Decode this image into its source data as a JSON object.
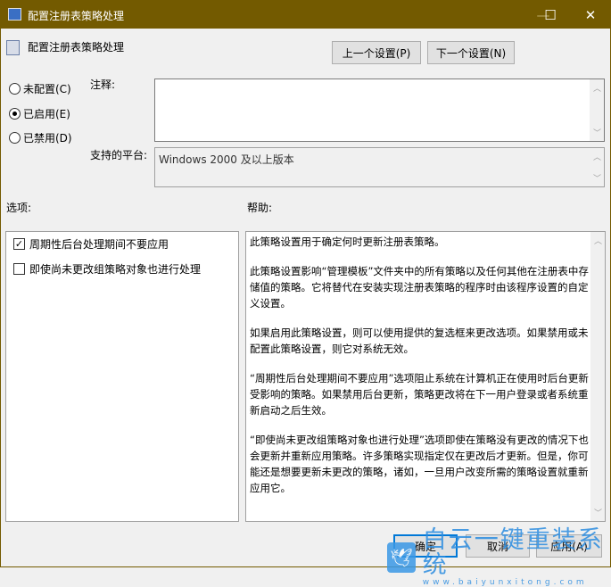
{
  "window": {
    "title": "配置注册表策略处理",
    "controls": {
      "minimize": "—",
      "maximize": "☐",
      "close": "✕"
    }
  },
  "header": {
    "policy_name": "配置注册表策略处理",
    "prev_button": "上一个设置(P)",
    "next_button": "下一个设置(N)"
  },
  "state": {
    "options": [
      {
        "label": "未配置(C)",
        "selected": false
      },
      {
        "label": "已启用(E)",
        "selected": true
      },
      {
        "label": "已禁用(D)",
        "selected": false
      }
    ]
  },
  "comment": {
    "label": "注释:",
    "value": ""
  },
  "platform": {
    "label": "支持的平台:",
    "value": "Windows 2000 及以上版本"
  },
  "options_panel": {
    "label": "选项:",
    "checkboxes": [
      {
        "label": "周期性后台处理期间不要应用",
        "checked": true
      },
      {
        "label": "即使尚未更改组策略对象也进行处理",
        "checked": false
      }
    ]
  },
  "help_panel": {
    "label": "帮助:",
    "paragraphs": [
      "此策略设置用于确定何时更新注册表策略。",
      "此策略设置影响“管理模板”文件夹中的所有策略以及任何其他在注册表中存储值的策略。它将替代在安装实现注册表策略的程序时由该程序设置的自定义设置。",
      "如果启用此策略设置，则可以使用提供的复选框来更改选项。如果禁用或未配置此策略设置，则它对系统无效。",
      "“周期性后台处理期间不要应用”选项阻止系统在计算机正在使用时后台更新受影响的策略。如果禁用后台更新，策略更改将在下一用户登录或者系统重新启动之后生效。",
      "“即使尚未更改组策略对象也进行处理”选项即使在策略没有更改的情况下也会更新并重新应用策略。许多策略实现指定仅在更改后才更新。但是，你可能还是想要更新未更改的策略，诸如，一旦用户改变所需的策略设置就重新应用它。"
    ]
  },
  "footer": {
    "ok": "确定",
    "cancel": "取消",
    "apply": "应用(A)"
  },
  "watermark": {
    "title": "白云一键重装系统",
    "url": "www.baiyunxitong.com"
  },
  "colors": {
    "titlebar": "#735a00",
    "accent": "#0078d7"
  }
}
